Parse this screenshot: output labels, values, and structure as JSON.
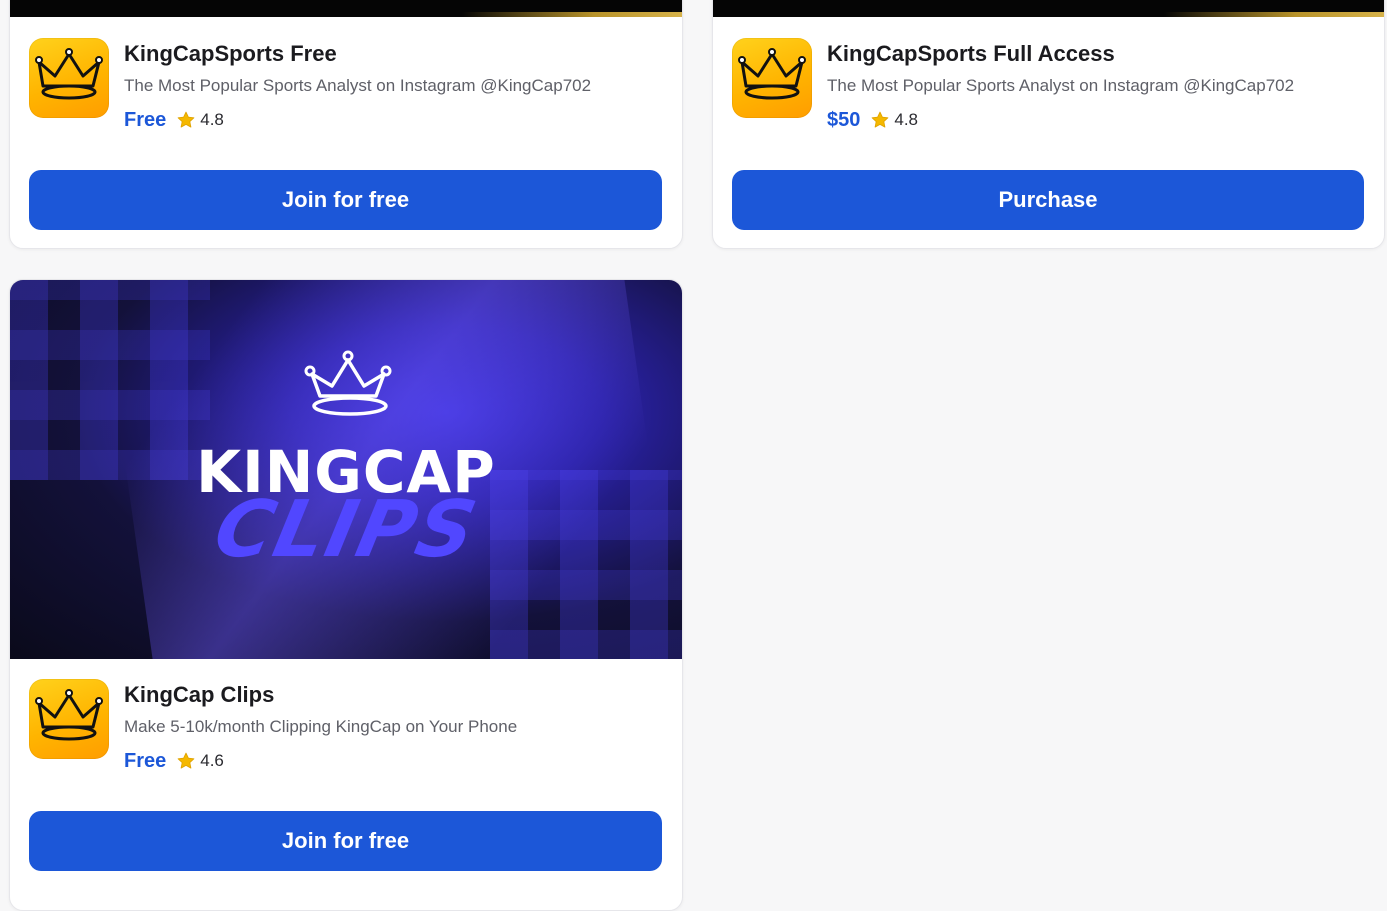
{
  "cards": [
    {
      "title": "KingCapSports Free",
      "description": "The Most Popular Sports Analyst on Instagram @KingCap702",
      "price": "Free",
      "rating": "4.8",
      "button_label": "Join for free"
    },
    {
      "title": "KingCapSports Full Access",
      "description": "The Most Popular Sports Analyst on Instagram @KingCap702",
      "price": "$50",
      "rating": "4.8",
      "button_label": "Purchase"
    },
    {
      "title": "KingCap Clips",
      "description": "Make 5-10k/month Clipping KingCap on Your Phone",
      "price": "Free",
      "rating": "4.6",
      "button_label": "Join for free",
      "banner": {
        "word": "KINGCAP",
        "script": "CLIPS"
      }
    }
  ],
  "icons": {
    "app": "crown-icon",
    "rating": "star-icon"
  },
  "colors": {
    "accent": "#1c57d8",
    "star": "#f5b800",
    "icon_bg": "#ffc20e"
  }
}
